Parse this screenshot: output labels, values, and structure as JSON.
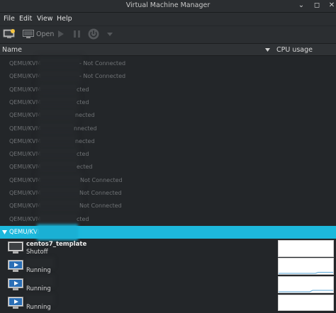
{
  "window": {
    "title": "Virtual Machine Manager"
  },
  "menu": {
    "items": [
      "File",
      "Edit",
      "View",
      "Help"
    ]
  },
  "toolbar": {
    "open_label": "Open"
  },
  "columns": {
    "name": "Name",
    "cpu": "CPU usage"
  },
  "connections": [
    {
      "name": "QEMU/KVM:",
      "status": "- Not Connected"
    },
    {
      "name": "QEMU/KVM:",
      "status": "- Not Connected"
    },
    {
      "name": "QEMU/KVM:",
      "status": "cted"
    },
    {
      "name": "QEMU/KVM:",
      "status": "cted"
    },
    {
      "name": "QEMU/KVM:",
      "status": "nected"
    },
    {
      "name": "QEMU/KVM:",
      "status": "nnected"
    },
    {
      "name": "QEMU/KVM:",
      "status": "nected"
    },
    {
      "name": "QEMU/KVM:",
      "status": "cted"
    },
    {
      "name": "QEMU/KVM:",
      "status": "ected"
    },
    {
      "name": "QEMU/KVM:",
      "status": "Not Connected"
    },
    {
      "name": "QEMU/KVM:",
      "status": "Not Connected"
    },
    {
      "name": "QEMU/KVM:",
      "status": "Not Connected"
    },
    {
      "name": "QEMU/KVM:",
      "status": "cted"
    }
  ],
  "selected_connection": {
    "name": "QEMU/KVM:"
  },
  "vms": [
    {
      "name": "centos7_template",
      "status": "Shutoff",
      "icon": "vm-off-icon"
    },
    {
      "name": "",
      "status": "Running",
      "icon": "vm-running-icon"
    },
    {
      "name": "",
      "status": "Running",
      "icon": "vm-running-icon"
    },
    {
      "name": "",
      "status": "Running",
      "icon": "vm-running-icon"
    }
  ],
  "colors": {
    "accent": "#1db8dc",
    "background": "#232629",
    "graph_line": "#5aa6d6"
  }
}
